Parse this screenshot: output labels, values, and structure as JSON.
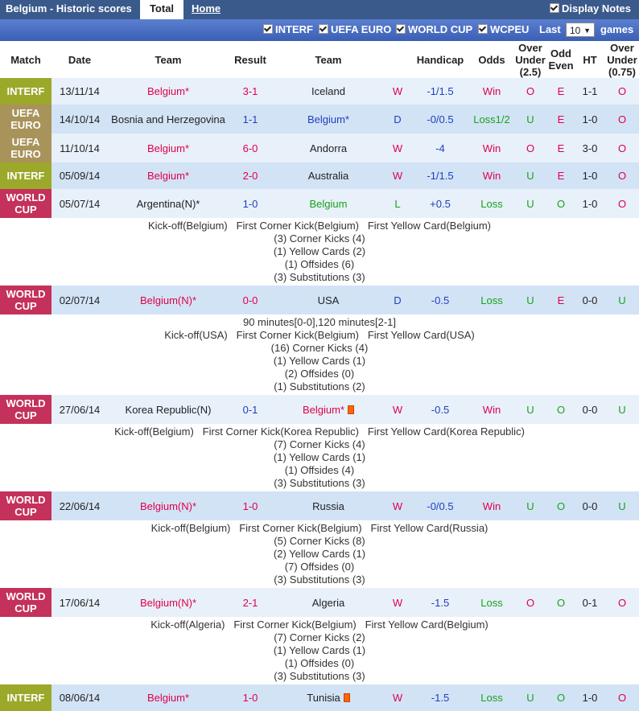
{
  "header": {
    "title": "Belgium - Historic scores",
    "tabs": [
      "Total",
      "Home"
    ],
    "display_notes": "Display Notes"
  },
  "filters": {
    "items": [
      "INTERF",
      "UEFA EURO",
      "WORLD CUP",
      "WCPEU"
    ],
    "last_label": "Last",
    "last_value": "10",
    "games_label": "games"
  },
  "columns": {
    "match": "Match",
    "date": "Date",
    "team1": "Team",
    "result": "Result",
    "team2": "Team",
    "handicap": "Handicap",
    "odds": "Odds",
    "over_under_1": "Over",
    "over_under_2": "Under",
    "over_under_3": "(2.5)",
    "odd_even_1": "Odd",
    "odd_even_2": "Even",
    "ht": "HT",
    "over_under2_1": "Over",
    "over_under2_2": "Under",
    "over_under2_3": "(0.75)"
  },
  "matches": [
    {
      "comp": [
        "INTERF"
      ],
      "date": "13/11/14",
      "home": "Belgium*",
      "score": "3-1",
      "away": "Iceland",
      "wl": "W",
      "hc": "-1/1.5",
      "odds": "Win",
      "ou": "O",
      "oe": "E",
      "ht": "1-1",
      "ou2": "O"
    },
    {
      "comp": [
        "UEFA",
        "EURO"
      ],
      "date": "14/10/14",
      "home": "Bosnia and Herzegovina",
      "score": "1-1",
      "away": "Belgium*",
      "wl": "D",
      "hc": "-0/0.5",
      "odds": "Loss1/2",
      "ou": "U",
      "oe": "E",
      "ht": "1-0",
      "ou2": "O"
    },
    {
      "comp": [
        "UEFA",
        "EURO"
      ],
      "date": "11/10/14",
      "home": "Belgium*",
      "score": "6-0",
      "away": "Andorra",
      "wl": "W",
      "hc": "-4",
      "odds": "Win",
      "ou": "O",
      "oe": "E",
      "ht": "3-0",
      "ou2": "O"
    },
    {
      "comp": [
        "INTERF"
      ],
      "date": "05/09/14",
      "home": "Belgium*",
      "score": "2-0",
      "away": "Australia",
      "wl": "W",
      "hc": "-1/1.5",
      "odds": "Win",
      "ou": "U",
      "oe": "E",
      "ht": "1-0",
      "ou2": "O"
    },
    {
      "comp": [
        "WORLD",
        "CUP"
      ],
      "date": "05/07/14",
      "home": "Argentina(N)*",
      "score": "1-0",
      "away": "Belgium",
      "wl": "L",
      "hc": "+0.5",
      "odds": "Loss",
      "ou": "U",
      "oe": "O",
      "ht": "1-0",
      "ou2": "O",
      "details": [
        "Kick-off(Belgium)   First Corner Kick(Belgium)   First Yellow Card(Belgium)",
        "(3) Corner Kicks (4)",
        "(1) Yellow Cards (2)",
        "(1) Offsides (6)",
        "(3) Substitutions (3)"
      ]
    },
    {
      "comp": [
        "WORLD",
        "CUP"
      ],
      "date": "02/07/14",
      "home": "Belgium(N)*",
      "score": "0-0",
      "away": "USA",
      "wl": "D",
      "hc": "-0.5",
      "odds": "Loss",
      "ou": "U",
      "oe": "E",
      "ht": "0-0",
      "ou2": "U",
      "details": [
        "90 minutes[0-0],120 minutes[2-1]",
        "Kick-off(USA)   First Corner Kick(Belgium)   First Yellow Card(USA)",
        "(16) Corner Kicks (4)",
        "(1) Yellow Cards (1)",
        "(2) Offsides (0)",
        "(1) Substitutions (2)"
      ]
    },
    {
      "comp": [
        "WORLD",
        "CUP"
      ],
      "date": "27/06/14",
      "home": "Korea Republic(N)",
      "score": "0-1",
      "away": "Belgium*",
      "wl": "W",
      "hc": "-0.5",
      "odds": "Win",
      "ou": "U",
      "oe": "O",
      "ht": "0-0",
      "ou2": "U",
      "card": "away",
      "details": [
        "Kick-off(Belgium)   First Corner Kick(Korea Republic)   First Yellow Card(Korea Republic)",
        "(7) Corner Kicks (4)",
        "(1) Yellow Cards (1)",
        "(1) Offsides (4)",
        "(3) Substitutions (3)"
      ]
    },
    {
      "comp": [
        "WORLD",
        "CUP"
      ],
      "date": "22/06/14",
      "home": "Belgium(N)*",
      "score": "1-0",
      "away": "Russia",
      "wl": "W",
      "hc": "-0/0.5",
      "odds": "Win",
      "ou": "U",
      "oe": "O",
      "ht": "0-0",
      "ou2": "U",
      "details": [
        "Kick-off(Belgium)   First Corner Kick(Belgium)   First Yellow Card(Russia)",
        "(5) Corner Kicks (8)",
        "(2) Yellow Cards (1)",
        "(7) Offsides (0)",
        "(3) Substitutions (3)"
      ]
    },
    {
      "comp": [
        "WORLD",
        "CUP"
      ],
      "date": "17/06/14",
      "home": "Belgium(N)*",
      "score": "2-1",
      "away": "Algeria",
      "wl": "W",
      "hc": "-1.5",
      "odds": "Loss",
      "ou": "O",
      "oe": "O",
      "ht": "0-1",
      "ou2": "O",
      "details": [
        "Kick-off(Algeria)   First Corner Kick(Belgium)   First Yellow Card(Belgium)",
        "(7) Corner Kicks (2)",
        "(1) Yellow Cards (1)",
        "(1) Offsides (0)",
        "(3) Substitutions (3)"
      ]
    },
    {
      "comp": [
        "INTERF"
      ],
      "date": "08/06/14",
      "home": "Belgium*",
      "score": "1-0",
      "away": "Tunisia",
      "wl": "W",
      "hc": "-1.5",
      "odds": "Loss",
      "ou": "U",
      "oe": "O",
      "ht": "1-0",
      "ou2": "O",
      "card": "away"
    }
  ],
  "colors": {
    "interf": "#9ca82a",
    "euro": "#a8935a",
    "worldcup": "#c4315a",
    "win": "#e0004a",
    "loss": "#17a31a",
    "draw": "#1e3fbf"
  }
}
